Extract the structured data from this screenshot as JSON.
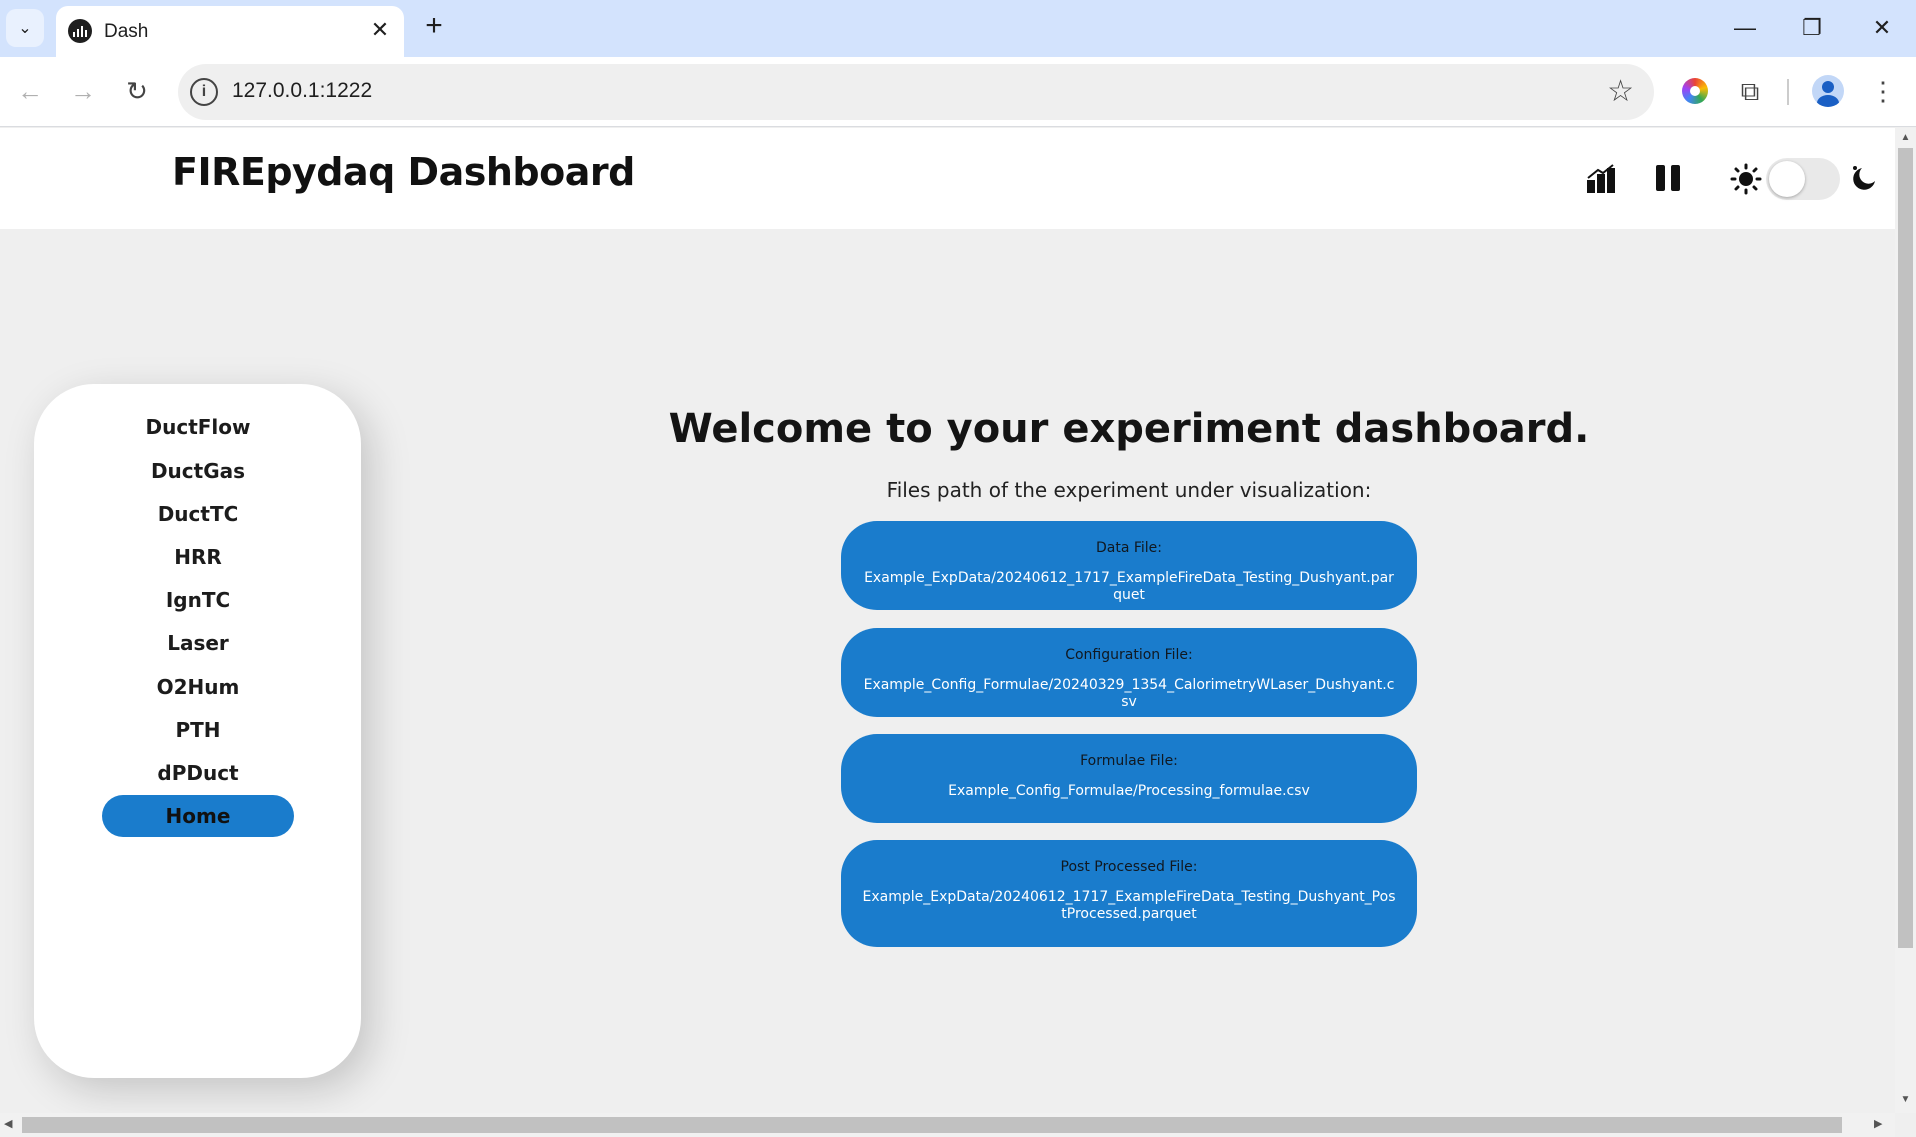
{
  "browser": {
    "tab_title": "Dash",
    "url": "127.0.0.1:1222",
    "tab_close_glyph": "✕",
    "new_tab_glyph": "+",
    "tab_search_glyph": "⌄",
    "minimize_glyph": "—",
    "restore_glyph": "❐",
    "close_glyph": "✕",
    "back_glyph": "←",
    "forward_glyph": "→",
    "reload_glyph": "↻",
    "site_info_glyph": "i",
    "bookmark_glyph": "☆",
    "extensions_glyph": "⧉",
    "menu_glyph": "⋮"
  },
  "header": {
    "title": "FIREpydaq Dashboard",
    "icons": [
      "chart-icon",
      "pause-icon",
      "sun-icon",
      "moon-icon"
    ],
    "theme_toggle_on": false
  },
  "sidebar": {
    "items": [
      {
        "label": "DuctFlow",
        "active": false
      },
      {
        "label": "DuctGas",
        "active": false
      },
      {
        "label": "DuctTC",
        "active": false
      },
      {
        "label": "HRR",
        "active": false
      },
      {
        "label": "IgnTC",
        "active": false
      },
      {
        "label": "Laser",
        "active": false
      },
      {
        "label": "O2Hum",
        "active": false
      },
      {
        "label": "PTH",
        "active": false
      },
      {
        "label": "dPDuct",
        "active": false
      },
      {
        "label": "Home",
        "active": true
      }
    ]
  },
  "main": {
    "welcome": "Welcome to your experiment dashboard.",
    "caption": "Files path of the experiment under visualization:",
    "files": [
      {
        "label": "Data File:",
        "path": "Example_ExpData/20240612_1717_ExampleFireData_Testing_Dushyant.parquet"
      },
      {
        "label": "Configuration File:",
        "path": "Example_Config_Formulae/20240329_1354_CalorimetryWLaser_Dushyant.csv"
      },
      {
        "label": "Formulae File:",
        "path": "Example_Config_Formulae/Processing_formulae.csv"
      },
      {
        "label": "Post Processed File:",
        "path": "Example_ExpData/20240612_1717_ExampleFireData_Testing_Dushyant_PostProcessed.parquet"
      }
    ]
  },
  "colors": {
    "accent": "#1a7ccc",
    "page_bg": "#efefef",
    "tabstrip": "#d3e3fd"
  }
}
